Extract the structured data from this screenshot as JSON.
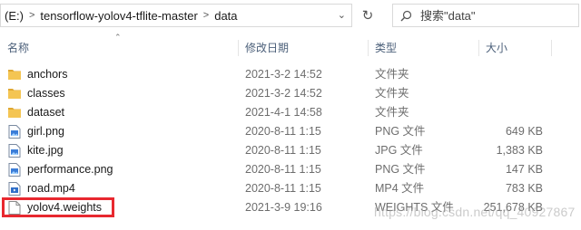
{
  "address_bar": {
    "drive": "(E:)",
    "folder": "tensorflow-yolov4-tflite-master",
    "current": "data"
  },
  "search": {
    "placeholder": "搜索\"data\""
  },
  "columns": {
    "name": "名称",
    "date": "修改日期",
    "type": "类型",
    "size": "大小"
  },
  "files": [
    {
      "name": "anchors",
      "date": "2021-3-2 14:52",
      "type": "文件夹",
      "size": "",
      "icon": "folder-icon"
    },
    {
      "name": "classes",
      "date": "2021-3-2 14:52",
      "type": "文件夹",
      "size": "",
      "icon": "folder-icon"
    },
    {
      "name": "dataset",
      "date": "2021-4-1 14:58",
      "type": "文件夹",
      "size": "",
      "icon": "folder-icon"
    },
    {
      "name": "girl.png",
      "date": "2020-8-11 1:15",
      "type": "PNG 文件",
      "size": "649 KB",
      "icon": "image-file-icon"
    },
    {
      "name": "kite.jpg",
      "date": "2020-8-11 1:15",
      "type": "JPG 文件",
      "size": "1,383 KB",
      "icon": "image-file-icon"
    },
    {
      "name": "performance.png",
      "date": "2020-8-11 1:15",
      "type": "PNG 文件",
      "size": "147 KB",
      "icon": "image-file-icon"
    },
    {
      "name": "road.mp4",
      "date": "2020-8-11 1:15",
      "type": "MP4 文件",
      "size": "783 KB",
      "icon": "video-file-icon"
    },
    {
      "name": "yolov4.weights",
      "date": "2021-3-9 19:16",
      "type": "WEIGHTS 文件",
      "size": "251,678 KB",
      "icon": "blank-file-icon"
    }
  ],
  "watermark": "https://blog.csdn.net/qq_40927867",
  "colors": {
    "folder": "#f4c553",
    "header_text": "#4c607a",
    "highlight": "#e8282f"
  }
}
